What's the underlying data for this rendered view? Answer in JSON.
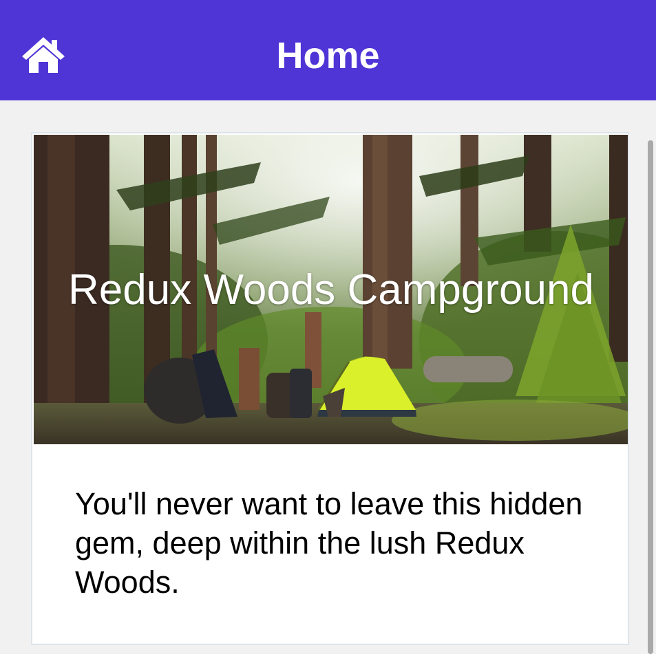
{
  "header": {
    "title": "Home",
    "home_icon": "home-icon",
    "background_color": "#4f35d6"
  },
  "card": {
    "title": "Redux Woods Campground",
    "description": "You'll never want to leave this hidden gem, deep within the lush Redux Woods.",
    "image": "forest-campsite-with-tent"
  }
}
